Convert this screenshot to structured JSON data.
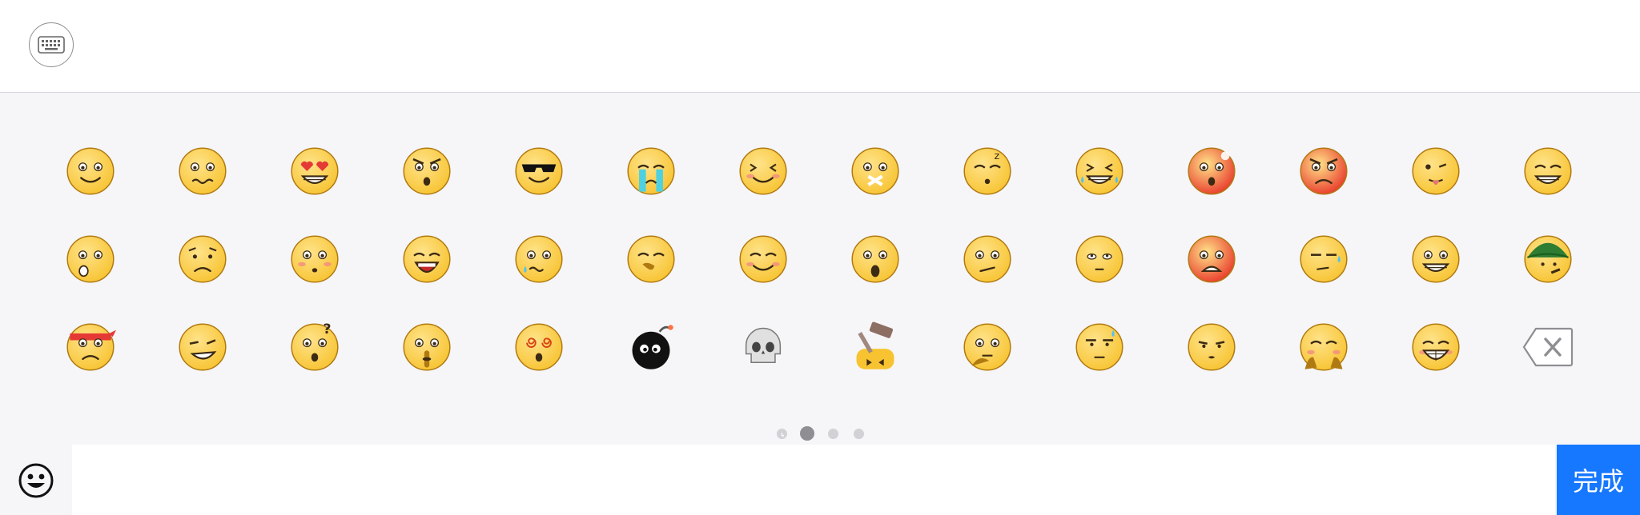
{
  "keyboard_toggle": {
    "icon": "keyboard-icon"
  },
  "emoji_panel": {
    "emojis": [
      {
        "name": "smile"
      },
      {
        "name": "awkward"
      },
      {
        "name": "heart-eyes"
      },
      {
        "name": "angry"
      },
      {
        "name": "cool-sunglasses"
      },
      {
        "name": "crying"
      },
      {
        "name": "shy-blush"
      },
      {
        "name": "shut-mouth"
      },
      {
        "name": "sleeping"
      },
      {
        "name": "tears-of-joy"
      },
      {
        "name": "embarrassed"
      },
      {
        "name": "furious"
      },
      {
        "name": "tongue-wink"
      },
      {
        "name": "grin"
      },
      {
        "name": "surprised"
      },
      {
        "name": "sad"
      },
      {
        "name": "flushed"
      },
      {
        "name": "screaming-cry"
      },
      {
        "name": "sweating-anxious"
      },
      {
        "name": "giggle"
      },
      {
        "name": "pleasant"
      },
      {
        "name": "shocked"
      },
      {
        "name": "confused"
      },
      {
        "name": "disdain"
      },
      {
        "name": "scared"
      },
      {
        "name": "speechless-sweat"
      },
      {
        "name": "happy"
      },
      {
        "name": "green-hat"
      },
      {
        "name": "ninja-headband"
      },
      {
        "name": "sly-grin"
      },
      {
        "name": "questioning"
      },
      {
        "name": "shush"
      },
      {
        "name": "dizzy"
      },
      {
        "name": "bomb"
      },
      {
        "name": "skull"
      },
      {
        "name": "hammer"
      },
      {
        "name": "thinking"
      },
      {
        "name": "speechless"
      },
      {
        "name": "pouting"
      },
      {
        "name": "holding-back-tears"
      },
      {
        "name": "teeth-grin"
      }
    ],
    "delete_icon": "backspace-icon"
  },
  "pager": {
    "pages": [
      "recent-clock-icon",
      "page-dot",
      "page-dot",
      "page-dot"
    ],
    "active_index": 1,
    "colors": {
      "active": "#8e8e93",
      "inactive": "#d1d1d6"
    }
  },
  "input_bar": {
    "emoji_button_icon": "smiley-icon",
    "input_value": "",
    "done_label": "完成"
  },
  "colors": {
    "accent": "#1677ff",
    "panel_bg": "#f6f6f8",
    "emoji_yellow": "#f7c331",
    "emoji_red": "#e8392a"
  }
}
